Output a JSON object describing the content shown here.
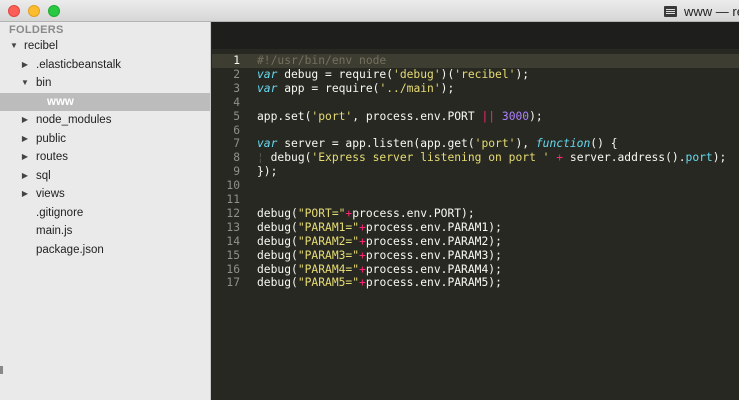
{
  "window": {
    "title": "www — re",
    "buttons": [
      "close",
      "minimize",
      "maximize"
    ]
  },
  "sidebar": {
    "header": "FOLDERS",
    "items": [
      {
        "label": "recibel",
        "expanded": true,
        "folder": true
      },
      {
        "label": ".elasticbeanstalk",
        "expanded": false,
        "folder": true
      },
      {
        "label": "bin",
        "expanded": true,
        "folder": true
      },
      {
        "label": "www",
        "selected": true,
        "folder": false
      },
      {
        "label": "node_modules",
        "expanded": false,
        "folder": true
      },
      {
        "label": "public",
        "expanded": false,
        "folder": true
      },
      {
        "label": "routes",
        "expanded": false,
        "folder": true
      },
      {
        "label": "sql",
        "expanded": false,
        "folder": true
      },
      {
        "label": "views",
        "expanded": false,
        "folder": true
      },
      {
        "label": ".gitignore",
        "folder": false
      },
      {
        "label": "main.js",
        "folder": false
      },
      {
        "label": "package.json",
        "folder": false
      }
    ]
  },
  "editor": {
    "current_line": 1,
    "lines": [
      {
        "n": "1",
        "tokens": [
          {
            "t": "#!/usr/bin/env node",
            "k": "comment"
          }
        ]
      },
      {
        "n": "2",
        "tokens": [
          {
            "t": "var",
            "k": "storage"
          },
          {
            "t": " debug = require(",
            "k": "plain"
          },
          {
            "t": "'debug'",
            "k": "string"
          },
          {
            "t": ")(",
            "k": "plain"
          },
          {
            "t": "'recibel'",
            "k": "string"
          },
          {
            "t": ");",
            "k": "plain"
          }
        ]
      },
      {
        "n": "3",
        "tokens": [
          {
            "t": "var",
            "k": "storage"
          },
          {
            "t": " app = require(",
            "k": "plain"
          },
          {
            "t": "'../main'",
            "k": "string"
          },
          {
            "t": ");",
            "k": "plain"
          }
        ]
      },
      {
        "n": "4",
        "tokens": []
      },
      {
        "n": "5",
        "tokens": [
          {
            "t": "app.set(",
            "k": "plain"
          },
          {
            "t": "'port'",
            "k": "string"
          },
          {
            "t": ", process.env.PORT ",
            "k": "plain"
          },
          {
            "t": "||",
            "k": "op"
          },
          {
            "t": " ",
            "k": "plain"
          },
          {
            "t": "3000",
            "k": "number"
          },
          {
            "t": ");",
            "k": "plain"
          }
        ]
      },
      {
        "n": "6",
        "tokens": []
      },
      {
        "n": "7",
        "tokens": [
          {
            "t": "var",
            "k": "storage"
          },
          {
            "t": " server = app.listen(app.get(",
            "k": "plain"
          },
          {
            "t": "'port'",
            "k": "string"
          },
          {
            "t": "), ",
            "k": "plain"
          },
          {
            "t": "function",
            "k": "storage"
          },
          {
            "t": "() {",
            "k": "plain"
          }
        ]
      },
      {
        "n": "8",
        "tokens": [
          {
            "t": "¦ ",
            "k": "guide"
          },
          {
            "t": "debug(",
            "k": "plain"
          },
          {
            "t": "'Express server listening on port '",
            "k": "string"
          },
          {
            "t": " ",
            "k": "plain"
          },
          {
            "t": "+",
            "k": "op"
          },
          {
            "t": " server.address().",
            "k": "plain"
          },
          {
            "t": "port",
            "k": "prop"
          },
          {
            "t": ");",
            "k": "plain"
          }
        ]
      },
      {
        "n": "9",
        "tokens": [
          {
            "t": "});",
            "k": "plain"
          }
        ]
      },
      {
        "n": "10",
        "tokens": []
      },
      {
        "n": "11",
        "tokens": []
      },
      {
        "n": "12",
        "tokens": [
          {
            "t": "debug(",
            "k": "plain"
          },
          {
            "t": "\"PORT=\"",
            "k": "string"
          },
          {
            "t": "+",
            "k": "op"
          },
          {
            "t": "process.env.PORT);",
            "k": "plain"
          }
        ]
      },
      {
        "n": "13",
        "tokens": [
          {
            "t": "debug(",
            "k": "plain"
          },
          {
            "t": "\"PARAM1=\"",
            "k": "string"
          },
          {
            "t": "+",
            "k": "op"
          },
          {
            "t": "process.env.PARAM1);",
            "k": "plain"
          }
        ]
      },
      {
        "n": "14",
        "tokens": [
          {
            "t": "debug(",
            "k": "plain"
          },
          {
            "t": "\"PARAM2=\"",
            "k": "string"
          },
          {
            "t": "+",
            "k": "op"
          },
          {
            "t": "process.env.PARAM2);",
            "k": "plain"
          }
        ]
      },
      {
        "n": "15",
        "tokens": [
          {
            "t": "debug(",
            "k": "plain"
          },
          {
            "t": "\"PARAM3=\"",
            "k": "string"
          },
          {
            "t": "+",
            "k": "op"
          },
          {
            "t": "process.env.PARAM3);",
            "k": "plain"
          }
        ]
      },
      {
        "n": "16",
        "tokens": [
          {
            "t": "debug(",
            "k": "plain"
          },
          {
            "t": "\"PARAM4=\"",
            "k": "string"
          },
          {
            "t": "+",
            "k": "op"
          },
          {
            "t": "process.env.PARAM4);",
            "k": "plain"
          }
        ]
      },
      {
        "n": "17",
        "tokens": [
          {
            "t": "debug(",
            "k": "plain"
          },
          {
            "t": "\"PARAM5=\"",
            "k": "string"
          },
          {
            "t": "+",
            "k": "op"
          },
          {
            "t": "process.env.PARAM5);",
            "k": "plain"
          }
        ]
      }
    ]
  },
  "theme": {
    "background": "#272822",
    "comment": "#75715e",
    "storage": "#66d9ef",
    "string": "#e6db74",
    "number": "#ae81ff",
    "operator": "#f92672"
  }
}
